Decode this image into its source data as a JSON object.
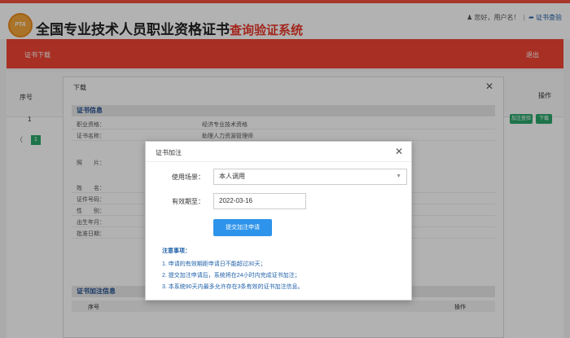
{
  "header": {
    "logo_text": "PTA",
    "title_main": "全国专业技术人员职业资格证书",
    "title_sub": "查询验证系统",
    "greeting": "您好，",
    "username": "用户名",
    "user_suffix": "！",
    "cert_verify_link": "证书查验"
  },
  "navbar": {
    "tab_label": "证书下载",
    "logout_label": "退出"
  },
  "background": {
    "col_index": "序号",
    "col_ops": "操作",
    "row_index": "1",
    "verify_btn": "加注查验",
    "download_btn": "下载",
    "page_number": "1",
    "pager_prev": "〈"
  },
  "download_modal": {
    "title": "下载",
    "cert_section": "证书信息",
    "rows": [
      {
        "label": "职业资格：",
        "value": "经济专业技术资格"
      },
      {
        "label": "证书名称：",
        "value": "助理人力资源管理师"
      }
    ],
    "photo_label": "照　　片：",
    "person_rows": [
      {
        "label": "姓　　名："
      },
      {
        "label": "证件号码："
      },
      {
        "label": "性　　别："
      },
      {
        "label": "出生年月："
      },
      {
        "label": "批准日期："
      }
    ],
    "record_section": "证书加注信息",
    "record_col_index": "序号",
    "record_col_ops": "操作"
  },
  "annotate_modal": {
    "title": "证书加注",
    "scene_label": "使用场景：",
    "scene_value": "本人调用",
    "expiry_label": "有效期至：",
    "expiry_value": "2022-03-16",
    "submit_label": "提交加注申请",
    "notes_title": "注意事项：",
    "notes": [
      "1. 申请的有效期距申请日不能超过30天；",
      "2. 提交加注申请后，系统将在24小时内完成证书加注；",
      "3. 本系统90天内最多允许存在3条有效的证书加注信息。"
    ]
  }
}
